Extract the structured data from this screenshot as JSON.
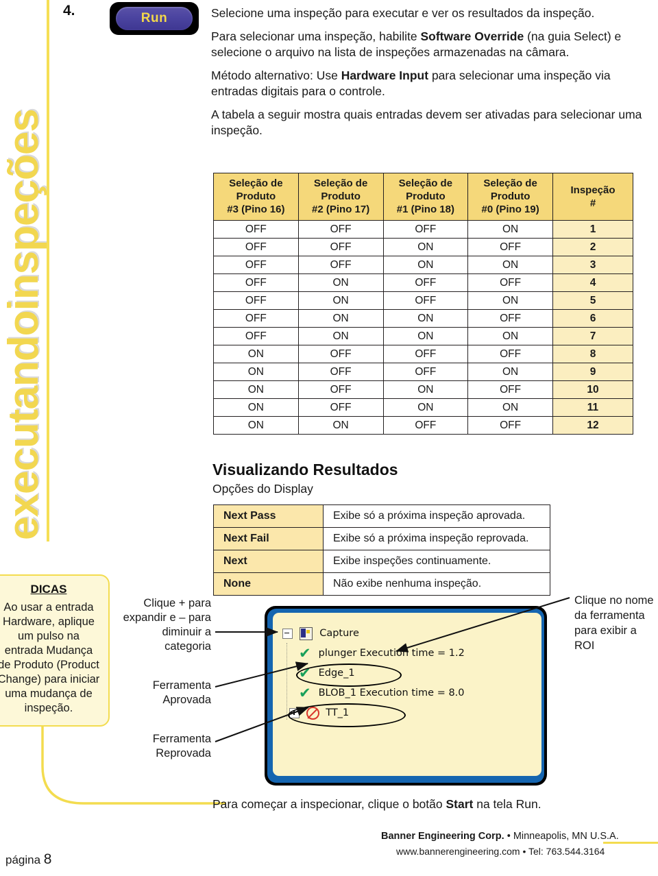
{
  "sidebar": {
    "vertical_tab_text": "executandoinspeções",
    "tip": {
      "title": "DICAS",
      "body": "Ao usar a entrada Hardware, aplique um pulso na entrada Mudança de Produto (Product Change) para iniciar uma mudança de inspeção."
    }
  },
  "step": {
    "number": "4.",
    "run_button_label": "Run"
  },
  "paragraphs": [
    {
      "parts": [
        {
          "text": "Selecione uma inspeção para executar e ver os resultados da inspeção.",
          "bold": false
        }
      ]
    },
    {
      "parts": [
        {
          "text": "Para selecionar uma inspeção, habilite ",
          "bold": false
        },
        {
          "text": "Software Override",
          "bold": true
        },
        {
          "text": " (na guia Select) e selecione o arquivo na lista de inspeções armazenadas na câmara.",
          "bold": false
        }
      ]
    },
    {
      "parts": [
        {
          "text": "Método alternativo: Use ",
          "bold": false
        },
        {
          "text": "Hardware Input",
          "bold": true
        },
        {
          "text": " para selecionar uma inspeção via entradas digitais para o controle.",
          "bold": false
        }
      ]
    },
    {
      "parts": [
        {
          "text": "A tabela a seguir mostra quais entradas devem ser ativadas para selecionar uma inspeção.",
          "bold": false
        }
      ]
    }
  ],
  "pin_table": {
    "headers": [
      "Seleção de Produto #3 (Pino 16)",
      "Seleção de Produto #2 (Pino 17)",
      "Seleção de Produto #1 (Pino 18)",
      "Seleção de Produto #0 (Pino 19)",
      "Inspeção #"
    ],
    "header_lines": [
      [
        "Seleção de",
        "Produto",
        "#3 (Pino 16)"
      ],
      [
        "Seleção de",
        "Produto",
        "#2 (Pino 17)"
      ],
      [
        "Seleção de",
        "Produto",
        "#1 (Pino 18)"
      ],
      [
        "Seleção de",
        "Produto",
        "#0 (Pino 19)"
      ],
      [
        "Inspeção",
        "#"
      ]
    ],
    "rows": [
      [
        "OFF",
        "OFF",
        "OFF",
        "ON",
        "1"
      ],
      [
        "OFF",
        "OFF",
        "ON",
        "OFF",
        "2"
      ],
      [
        "OFF",
        "OFF",
        "ON",
        "ON",
        "3"
      ],
      [
        "OFF",
        "ON",
        "OFF",
        "OFF",
        "4"
      ],
      [
        "OFF",
        "ON",
        "OFF",
        "ON",
        "5"
      ],
      [
        "OFF",
        "ON",
        "ON",
        "OFF",
        "6"
      ],
      [
        "OFF",
        "ON",
        "ON",
        "ON",
        "7"
      ],
      [
        "ON",
        "OFF",
        "OFF",
        "OFF",
        "8"
      ],
      [
        "ON",
        "OFF",
        "OFF",
        "ON",
        "9"
      ],
      [
        "ON",
        "OFF",
        "ON",
        "OFF",
        "10"
      ],
      [
        "ON",
        "OFF",
        "ON",
        "ON",
        "11"
      ],
      [
        "ON",
        "ON",
        "OFF",
        "OFF",
        "12"
      ]
    ]
  },
  "results": {
    "title": "Visualizando Resultados",
    "subtitle": "Opções do Display",
    "options": [
      {
        "name": "Next Pass",
        "description": "Exibe só a próxima inspeção aprovada."
      },
      {
        "name": "Next Fail",
        "description": "Exibe só a próxima inspeção reprovada."
      },
      {
        "name": "Next",
        "description": "Exibe inspeções continuamente."
      },
      {
        "name": "None",
        "description": "Não exibe nenhuma inspeção."
      }
    ]
  },
  "captions": {
    "expand": "Clique + para expandir e – para diminuir a categoria",
    "tool_pass": "Ferramenta Aprovada",
    "tool_fail": "Ferramenta Reprovada",
    "roi": "Clique no nome da ferramenta para exibir a ROI"
  },
  "tree_panel": {
    "rows": [
      {
        "label": "Capture",
        "icon": "capture-icon",
        "toggle": "minus"
      },
      {
        "label": "plunger Execution time = 1.2",
        "icon": "check-icon",
        "toggle": "none"
      },
      {
        "label": "Edge_1",
        "icon": "check-icon",
        "toggle": "none"
      },
      {
        "label": "BLOB_1 Execution time = 8.0",
        "icon": "check-icon",
        "toggle": "none"
      },
      {
        "label": "TT_1",
        "icon": "no-entry-icon",
        "toggle": "plus"
      }
    ]
  },
  "footer": {
    "instruction_pre": "Para começar a inspecionar, clique o botão ",
    "instruction_bold": "Start",
    "instruction_post": " na tela Run.",
    "company": "Banner Engineering Corp.",
    "company_sep": " • ",
    "location": "Minneapolis, MN U.S.A.",
    "website": "www.bannerengineering.com",
    "web_sep": "  •  ",
    "phone": "Tel: 763.544.3164",
    "page_label": "página ",
    "page_number": "8"
  },
  "colors": {
    "brand_yellow": "#f3dc4f",
    "table_header": "#f5d87a",
    "table_highlight": "#fbeec0",
    "tip_bg": "#fdf8d8",
    "panel_blue": "#1565b0",
    "panel_cream": "#fbf3c8",
    "check_green": "#19a05a",
    "fail_red": "#d9342b",
    "run_button_text": "#f3d84a"
  }
}
